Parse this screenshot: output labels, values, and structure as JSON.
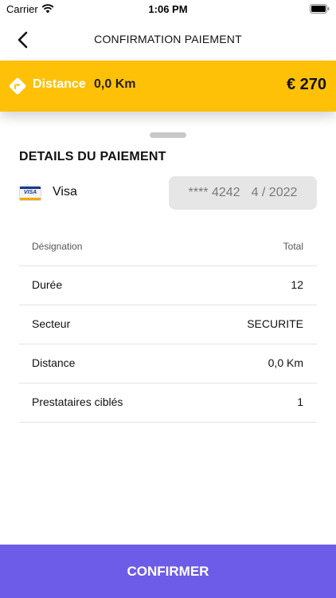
{
  "status_bar": {
    "carrier": "Carrier",
    "time": "1:06 PM"
  },
  "nav": {
    "title": "CONFIRMATION PAIEMENT",
    "back_icon": "chevron-left-icon"
  },
  "banner": {
    "icon": "direction-icon",
    "label": "Distance",
    "distance": "0,0 Km",
    "price": "€ 270",
    "color": "#ffc107"
  },
  "payment": {
    "title": "DETAILS DU PAIEMENT",
    "card_logo_text": "VISA",
    "card_brand": "Visa",
    "card_number": "**** 4242",
    "card_expiry": "4 / 2022"
  },
  "details_table": {
    "headers": [
      "Désignation",
      "Total"
    ],
    "rows": [
      [
        "Durée",
        "12"
      ],
      [
        "Secteur",
        "SECURITE"
      ],
      [
        "Distance",
        "0,0 Km"
      ],
      [
        "Prestataires ciblés",
        "1"
      ]
    ]
  },
  "confirm": {
    "label": "CONFIRMER",
    "color": "#6c5ce7"
  }
}
